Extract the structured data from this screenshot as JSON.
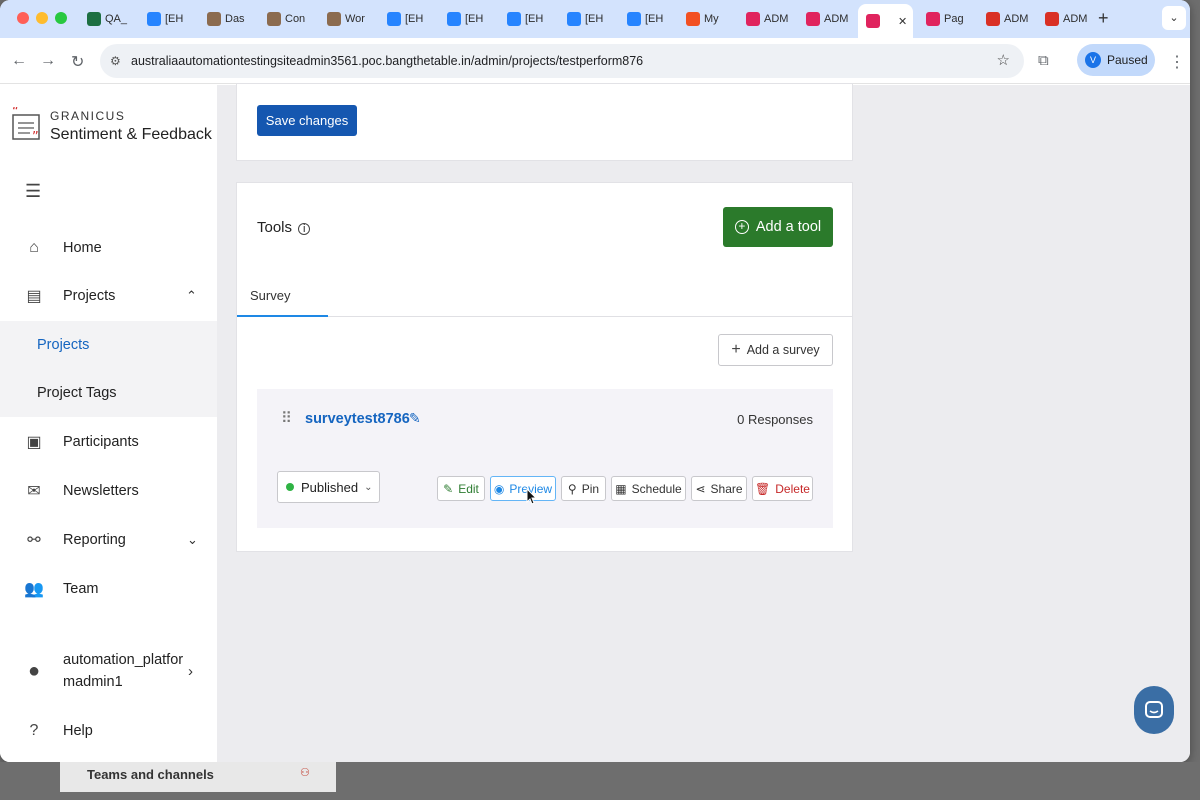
{
  "browser": {
    "tabs": [
      {
        "label": "QA_",
        "icon": "excel-icon",
        "color": "#1d6f42"
      },
      {
        "label": "[EH",
        "icon": "jira-icon",
        "color": "#2684ff"
      },
      {
        "label": "Das",
        "icon": "avatar-icon",
        "color": "#8b6b4f"
      },
      {
        "label": "Con",
        "icon": "avatar-icon",
        "color": "#8b6b4f"
      },
      {
        "label": "Wor",
        "icon": "avatar-icon",
        "color": "#8b6b4f"
      },
      {
        "label": "[EH",
        "icon": "jira-icon",
        "color": "#2684ff"
      },
      {
        "label": "[EH",
        "icon": "jira-icon",
        "color": "#2684ff"
      },
      {
        "label": "[EH",
        "icon": "jira-icon",
        "color": "#2684ff"
      },
      {
        "label": "[EH",
        "icon": "jira-icon",
        "color": "#2684ff"
      },
      {
        "label": "[EH",
        "icon": "jira-icon",
        "color": "#2684ff"
      },
      {
        "label": "My",
        "icon": "microsoft-icon",
        "color": "#f25022"
      },
      {
        "label": "ADM",
        "icon": "granicus-icon",
        "color": "#e0245e"
      },
      {
        "label": "ADM",
        "icon": "granicus-icon",
        "color": "#e0245e"
      },
      {
        "label": "",
        "icon": "granicus-icon",
        "color": "#e0245e"
      },
      {
        "label": "Pag",
        "icon": "granicus-icon",
        "color": "#e0245e"
      },
      {
        "label": "ADM",
        "icon": "calendar-icon",
        "color": "#d93025"
      },
      {
        "label": "ADM",
        "icon": "calendar-icon",
        "color": "#d93025"
      }
    ],
    "url": "australiaautomationtestingsiteadmin3561.poc.bangthetable.in/admin/projects/testperform876",
    "profile_initial": "V",
    "profile_status": "Paused"
  },
  "sidebar": {
    "brand_top": "GRANICUS",
    "brand_name": "Sentiment & Feedback",
    "items": {
      "home": "Home",
      "projects": "Projects",
      "projects_sub": "Projects",
      "project_tags": "Project Tags",
      "participants": "Participants",
      "newsletters": "Newsletters",
      "reporting": "Reporting",
      "team": "Team",
      "user_line1": "automation_platfor",
      "user_line2": "madmin1",
      "help": "Help"
    }
  },
  "main": {
    "save_label": "Save changes",
    "tools_title": "Tools",
    "add_tool_label": "Add a tool",
    "tab_survey": "Survey",
    "add_survey_label": "Add a survey",
    "survey": {
      "name": "surveytest8786",
      "responses": "0 Responses",
      "status": "Published",
      "actions": {
        "edit": "Edit",
        "preview": "Preview",
        "pin": "Pin",
        "schedule": "Schedule",
        "share": "Share",
        "delete": "Delete"
      }
    }
  },
  "background": {
    "teams_label": "Teams and channels"
  },
  "colors": {
    "primary": "#1557b0",
    "green": "#2b7a2b",
    "link": "#1565c0",
    "danger": "#c62828",
    "status_dot": "#2fb344"
  }
}
